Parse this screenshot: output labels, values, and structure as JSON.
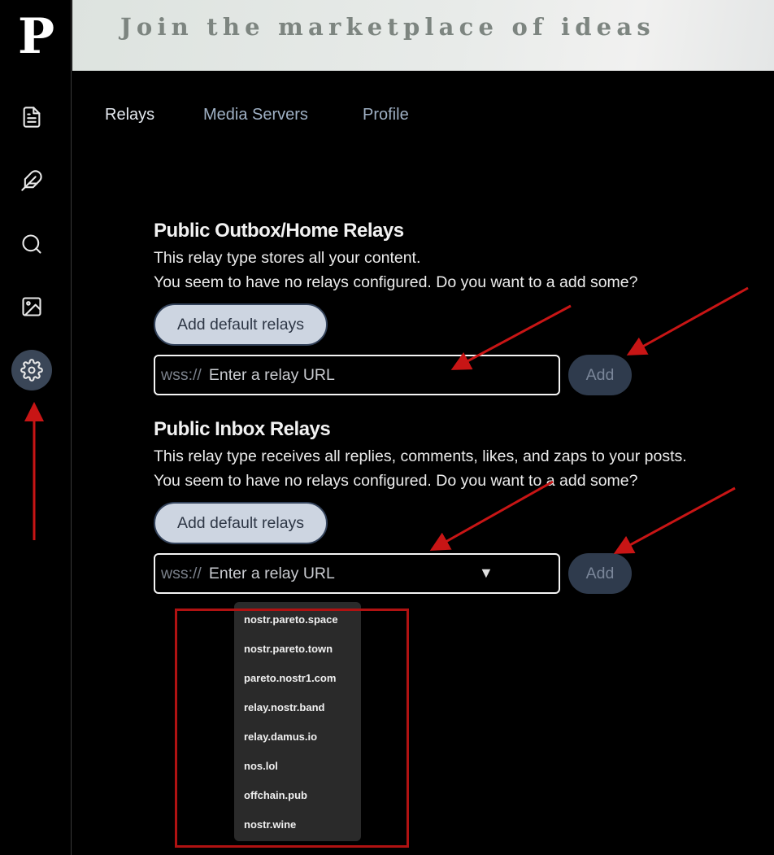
{
  "sidebar": {
    "logo": "P",
    "items": [
      {
        "icon": "document-icon"
      },
      {
        "icon": "feather-icon"
      },
      {
        "icon": "search-icon"
      },
      {
        "icon": "image-icon"
      },
      {
        "icon": "gear-icon",
        "active": true
      }
    ]
  },
  "banner": {
    "text": "Join the marketplace of ideas"
  },
  "tabs": [
    {
      "label": "Relays",
      "active": true
    },
    {
      "label": "Media Servers"
    },
    {
      "label": "Profile"
    }
  ],
  "outbox": {
    "title": "Public Outbox/Home Relays",
    "description": "This relay type stores all your content.",
    "empty_message": "You seem to have no relays configured. Do you want to a add some?",
    "default_button": "Add default relays",
    "url_prefix": "wss://",
    "url_placeholder": "Enter a relay URL",
    "add_button": "Add"
  },
  "inbox": {
    "title": "Public Inbox Relays",
    "description": "This relay type receives all replies, comments, likes, and zaps to your posts.",
    "empty_message": "You seem to have no relays configured. Do you want to a add some?",
    "default_button": "Add default relays",
    "url_prefix": "wss://",
    "url_placeholder": "Enter a relay URL",
    "add_button": "Add",
    "caret": "▼"
  },
  "relay_suggestions": [
    "nostr.pareto.space",
    "nostr.pareto.town",
    "pareto.nostr1.com",
    "relay.nostr.band",
    "relay.damus.io",
    "nos.lol",
    "offchain.pub",
    "nostr.wine"
  ],
  "colors": {
    "accent_dark": "#33425a",
    "button_light": "#cdd5e1",
    "annotation_red": "#b01212"
  }
}
